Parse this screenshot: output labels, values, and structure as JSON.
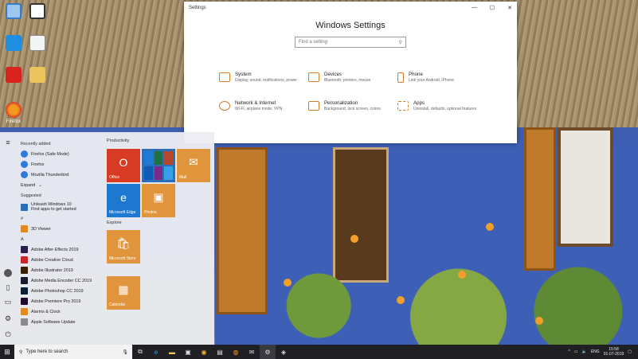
{
  "desktop": {
    "icons": [
      {
        "name": "this-pc",
        "label": ""
      },
      {
        "name": "user-folder",
        "label": ""
      },
      {
        "name": "app-blue",
        "label": ""
      },
      {
        "name": "document",
        "label": ""
      },
      {
        "name": "adobe-app",
        "label": ""
      },
      {
        "name": "folder",
        "label": ""
      },
      {
        "name": "firefox",
        "label": "Firefox"
      }
    ]
  },
  "settings": {
    "window_title": "Settings",
    "heading": "Windows Settings",
    "search_placeholder": "Find a setting",
    "items": [
      {
        "title": "System",
        "desc": "Display, sound, notifications, power",
        "icon": "laptop-icon"
      },
      {
        "title": "Devices",
        "desc": "Bluetooth, printers, mouse",
        "icon": "devices-icon"
      },
      {
        "title": "Phone",
        "desc": "Link your Android, iPhone",
        "icon": "phone-icon"
      },
      {
        "title": "Network & Internet",
        "desc": "Wi-Fi, airplane mode, VPN",
        "icon": "globe-icon"
      },
      {
        "title": "Personalization",
        "desc": "Background, lock screen, colors",
        "icon": "brush-icon"
      },
      {
        "title": "Apps",
        "desc": "Uninstall, defaults, optional features",
        "icon": "apps-icon"
      }
    ],
    "accent": "#d27a26"
  },
  "start": {
    "recently_added_label": "Recently added",
    "recent": [
      {
        "label": "Firefox (Safe Mode)",
        "color": "#2f7ad8"
      },
      {
        "label": "Firefox",
        "color": "#2f7ad8"
      },
      {
        "label": "Mozilla Thunderbird",
        "color": "#2f7ad8"
      }
    ],
    "expand_label": "Expand",
    "suggested_label": "Suggested",
    "suggested": [
      {
        "label": "Unleash Windows 10",
        "sub": "Find apps to get started",
        "color": "#2a6fb8"
      }
    ],
    "hash_label": "#",
    "hash_apps": [
      {
        "label": "3D Viewer",
        "color": "#e08a20"
      }
    ],
    "a_label": "A",
    "a_apps": [
      {
        "label": "Adobe After Effects 2019",
        "color": "#2a1d4a"
      },
      {
        "label": "Adobe Creative Cloud",
        "color": "#c8262b"
      },
      {
        "label": "Adobe Illustrator 2019",
        "color": "#3a1f07"
      },
      {
        "label": "Adobe Media Encoder CC 2019",
        "color": "#1a1a2e"
      },
      {
        "label": "Adobe Photoshop CC 2019",
        "color": "#0b2033"
      },
      {
        "label": "Adobe Premiere Pro 2019",
        "color": "#1f0a2e"
      },
      {
        "label": "Alarms & Clock",
        "color": "#e08a20"
      },
      {
        "label": "Apple Software Update",
        "color": "#8a8a8a"
      }
    ],
    "productivity_label": "Productivity",
    "explore_label": "Explore",
    "tiles": [
      {
        "name": "tile-office",
        "label": "Office",
        "color": "#d83b24",
        "glyph": "O"
      },
      {
        "name": "tile-mail",
        "label": "Mail",
        "color": "#e0953c",
        "glyph": "✉"
      },
      {
        "name": "tile-edge",
        "label": "Microsoft Edge",
        "color": "#1f78d0",
        "glyph": "e"
      },
      {
        "name": "tile-photos",
        "label": "Photos",
        "color": "#e0953c",
        "glyph": "▣"
      },
      {
        "name": "tile-store",
        "label": "Microsoft Store",
        "color": "#e0953c",
        "glyph": "🛍"
      },
      {
        "name": "tile-calendar",
        "label": "Calendar",
        "color": "#e0953c",
        "glyph": "▦"
      }
    ]
  },
  "taskbar": {
    "search_placeholder": "Type here to search",
    "language": "ENG",
    "time": "15:58",
    "date": "01-07-2019"
  }
}
